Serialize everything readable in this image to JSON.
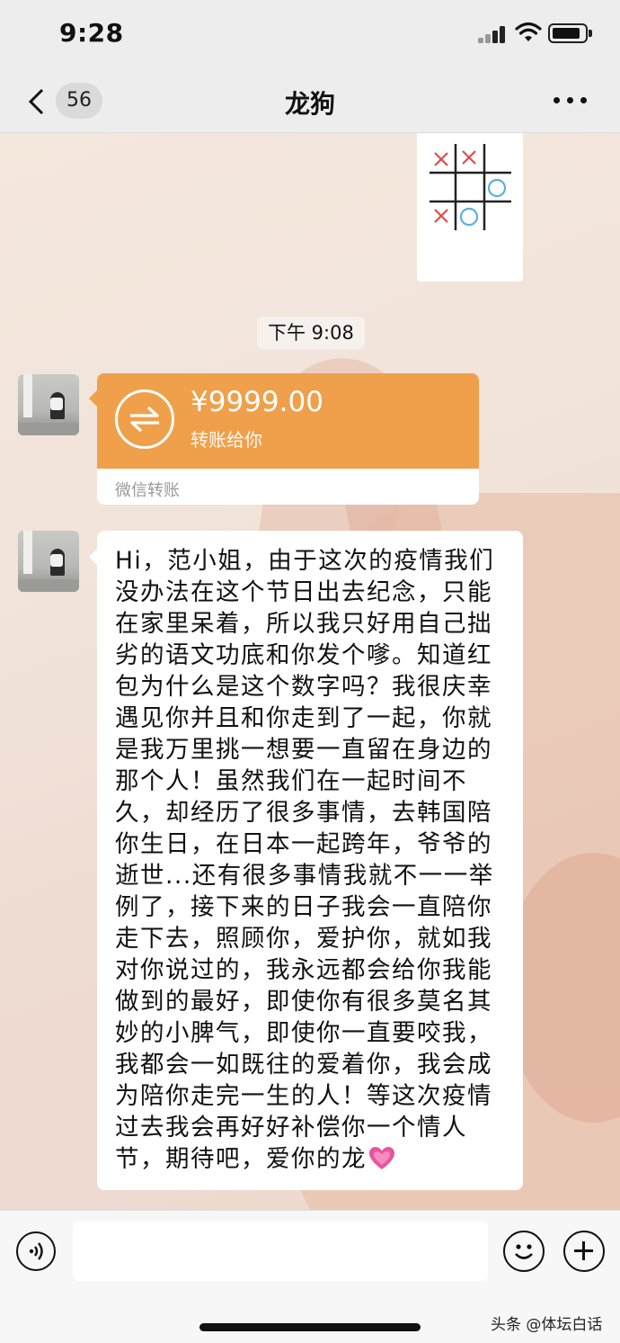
{
  "status_bar": {
    "time": "9:28"
  },
  "nav": {
    "unread_count": "56",
    "title": "龙狗"
  },
  "messages": {
    "timestamp": "下午 9:08",
    "transfer": {
      "amount": "¥9999.00",
      "label": "转账给你",
      "footer": "微信转账",
      "color": "#f0a04b"
    },
    "text": "Hi，范小姐，由于这次的疫情我们没办法在这个节日出去纪念，只能在家里呆着，所以我只好用自己拙劣的语文功底和你发个嗲。知道红包为什么是这个数字吗？我很庆幸遇见你并且和你走到了一起，你就是我万里挑一想要一直留在身边的那个人！虽然我们在一起时间不久，却经历了很多事情，去韩国陪你生日，在日本一起跨年，爷爷的逝世...还有很多事情我就不一一举例了，接下来的日子我会一直陪你走下去，照顾你，爱护你，就如我对你说过的，我永远都会给你我能做到的最好，即使你有很多莫名其妙的小脾气，即使你一直要咬我，我都会一如既往的爱着你，我会成为陪你走完一生的人！等这次疫情过去我会再好好补偿你一个情人节，期待吧，爱你的龙",
    "text_emoji": "pink-heart-icon"
  },
  "input": {
    "placeholder": ""
  },
  "watermark": "头条 @体坛白话"
}
